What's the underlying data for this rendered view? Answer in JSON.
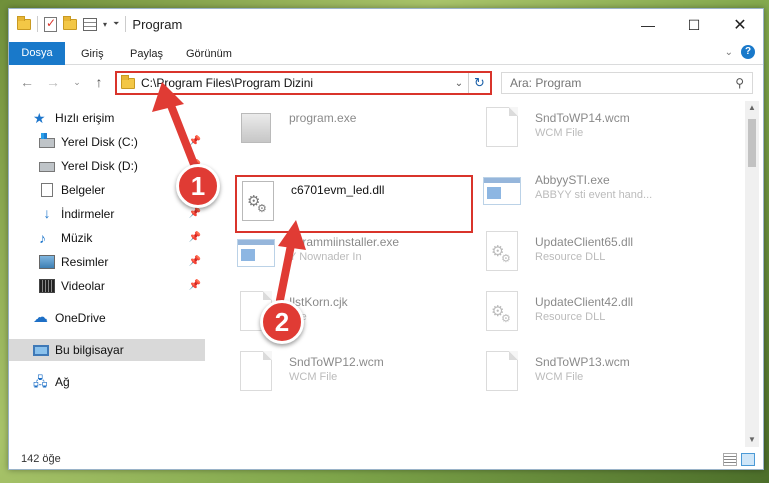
{
  "window": {
    "title": "Program",
    "controls": {
      "minimize": "—",
      "maximize": "☐",
      "close": "✕"
    }
  },
  "ribbon": {
    "tabs": [
      "Dosya",
      "Giriş",
      "Paylaş",
      "Görünüm"
    ],
    "help": "?"
  },
  "nav": {
    "address": "C:\\Program Files\\Program Dizini",
    "search_placeholder": "Ara: Program"
  },
  "sidebar": {
    "items": [
      {
        "label": "Hızlı erişim",
        "icon": "star-icon"
      },
      {
        "label": "Yerel Disk (C:)",
        "icon": "drive-icon",
        "pinned": true
      },
      {
        "label": "Yerel Disk (D:)",
        "icon": "drive-icon",
        "pinned": true
      },
      {
        "label": "Belgeler",
        "icon": "documents-icon",
        "pinned": true
      },
      {
        "label": "İndirmeler",
        "icon": "downloads-icon",
        "pinned": true
      },
      {
        "label": "Müzik",
        "icon": "music-icon",
        "pinned": true
      },
      {
        "label": "Resimler",
        "icon": "pictures-icon",
        "pinned": true
      },
      {
        "label": "Videolar",
        "icon": "videos-icon",
        "pinned": true
      },
      {
        "label": "OneDrive",
        "icon": "onedrive-icon"
      },
      {
        "label": "Bu bilgisayar",
        "icon": "this-pc-icon",
        "selected": true
      },
      {
        "label": "Ağ",
        "icon": "network-icon"
      }
    ]
  },
  "files": {
    "left": [
      {
        "name": "program.exe",
        "desc": "",
        "icon": "exe-icon"
      },
      {
        "name": "ogrammiinstaller.exe",
        "desc": "Y Nownader In",
        "icon": "app-icon"
      },
      {
        "name": "IlstKorn.cjk",
        "desc": "File",
        "icon": "blank-file-icon"
      },
      {
        "name": "SndToWP12.wcm",
        "desc": "WCM File",
        "icon": "blank-file-icon"
      }
    ],
    "selected": {
      "name": "c6701evm_led.dll",
      "icon": "dll-gear-icon"
    },
    "right": [
      {
        "name": "SndToWP14.wcm",
        "desc": "WCM File",
        "icon": "blank-file-icon"
      },
      {
        "name": "AbbyySTI.exe",
        "desc": "ABBYY sti event hand...",
        "icon": "app-icon"
      },
      {
        "name": "UpdateClient65.dll",
        "desc": "Resource DLL",
        "icon": "dll-gear-icon"
      },
      {
        "name": "UpdateClient42.dll",
        "desc": "Resource DLL",
        "icon": "dll-gear-icon"
      },
      {
        "name": "SndToWP13.wcm",
        "desc": "WCM File",
        "icon": "blank-file-icon"
      }
    ]
  },
  "status": {
    "count": "142 öğe"
  },
  "annotations": {
    "step1": "1",
    "step2": "2",
    "color": "#e03b34"
  }
}
